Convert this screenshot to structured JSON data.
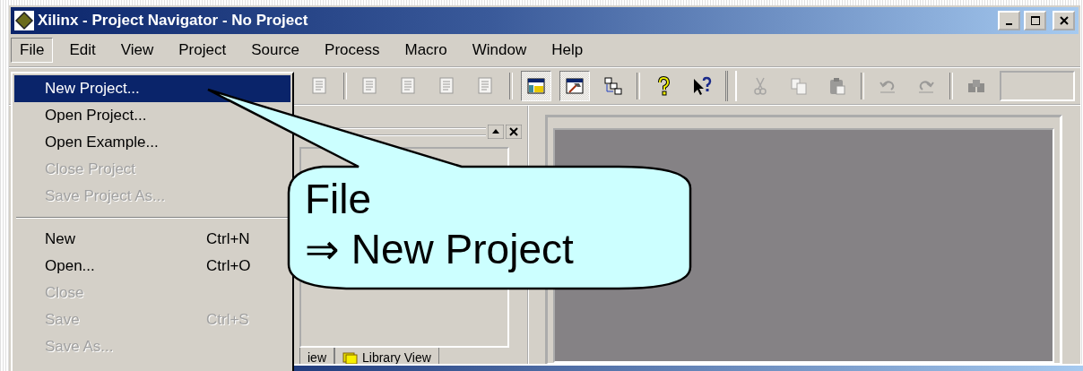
{
  "window": {
    "title": "Xilinx - Project Navigator - No Project"
  },
  "menu_bar": [
    {
      "label": "File",
      "selected": true
    },
    {
      "label": "Edit",
      "selected": false
    },
    {
      "label": "View",
      "selected": false
    },
    {
      "label": "Project",
      "selected": false
    },
    {
      "label": "Source",
      "selected": false
    },
    {
      "label": "Process",
      "selected": false
    },
    {
      "label": "Macro",
      "selected": false
    },
    {
      "label": "Window",
      "selected": false
    },
    {
      "label": "Help",
      "selected": false
    }
  ],
  "toolbar": [
    {
      "kind": "doc",
      "pressed": false,
      "disabled": true
    },
    {
      "kind": "separator"
    },
    {
      "kind": "doc",
      "pressed": false,
      "disabled": true
    },
    {
      "kind": "doc",
      "pressed": false,
      "disabled": true
    },
    {
      "kind": "doc",
      "pressed": false,
      "disabled": true
    },
    {
      "kind": "doc",
      "pressed": false,
      "disabled": true
    },
    {
      "kind": "separator"
    },
    {
      "kind": "window",
      "pressed": true,
      "disabled": false
    },
    {
      "kind": "hammer",
      "pressed": true,
      "disabled": false
    },
    {
      "kind": "hierarchy",
      "pressed": false,
      "disabled": false
    },
    {
      "kind": "separator"
    },
    {
      "kind": "help",
      "pressed": false,
      "disabled": false
    },
    {
      "kind": "whats-this",
      "pressed": false,
      "disabled": false
    },
    {
      "kind": "grip"
    },
    {
      "kind": "cut",
      "pressed": false,
      "disabled": true
    },
    {
      "kind": "copy",
      "pressed": false,
      "disabled": true
    },
    {
      "kind": "paste",
      "pressed": false,
      "disabled": true
    },
    {
      "kind": "separator"
    },
    {
      "kind": "undo",
      "pressed": false,
      "disabled": true
    },
    {
      "kind": "redo",
      "pressed": false,
      "disabled": true
    },
    {
      "kind": "separator"
    },
    {
      "kind": "find",
      "pressed": false,
      "disabled": true
    }
  ],
  "file_menu": [
    {
      "kind": "item",
      "label": "New Project...",
      "selected": true,
      "disabled": false
    },
    {
      "kind": "item",
      "label": "Open Project...",
      "selected": false,
      "disabled": false
    },
    {
      "kind": "item",
      "label": "Open Example...",
      "selected": false,
      "disabled": false
    },
    {
      "kind": "item",
      "label": "Close Project",
      "selected": false,
      "disabled": true
    },
    {
      "kind": "item",
      "label": "Save Project As...",
      "selected": false,
      "disabled": true
    },
    {
      "kind": "separator"
    },
    {
      "kind": "item",
      "label": "New",
      "shortcut": "Ctrl+N",
      "selected": false,
      "disabled": false
    },
    {
      "kind": "item",
      "label": "Open...",
      "shortcut": "Ctrl+O",
      "selected": false,
      "disabled": false
    },
    {
      "kind": "item",
      "label": "Close",
      "selected": false,
      "disabled": true
    },
    {
      "kind": "item",
      "label": "Save",
      "shortcut": "Ctrl+S",
      "selected": false,
      "disabled": true
    },
    {
      "kind": "item",
      "label": "Save As...",
      "selected": false,
      "disabled": true
    }
  ],
  "panel_tabs": [
    {
      "label": "iew",
      "icon": false
    },
    {
      "label": "Library View",
      "icon": true
    }
  ],
  "callout": {
    "lines": [
      "File",
      "⇒ New Project"
    ]
  }
}
